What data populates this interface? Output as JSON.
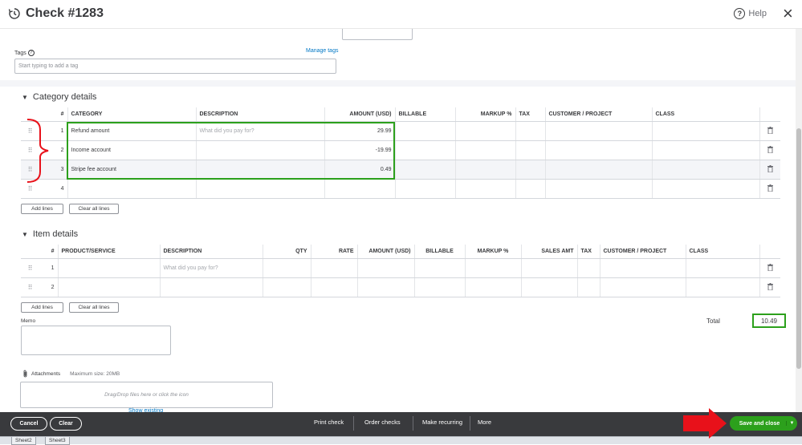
{
  "window": {
    "title": "Check #1283",
    "help_label": "Help",
    "help_glyph": "?",
    "close_glyph": "×"
  },
  "tags": {
    "label": "Tags",
    "info_glyph": "?",
    "manage_label": "Manage tags",
    "placeholder": "Start typing to add a tag"
  },
  "category_details": {
    "heading": "Category details",
    "columns": [
      "#",
      "CATEGORY",
      "DESCRIPTION",
      "AMOUNT (USD)",
      "BILLABLE",
      "MARKUP %",
      "TAX",
      "CUSTOMER / PROJECT",
      "CLASS"
    ],
    "rows": [
      {
        "num": "1",
        "category": "Refund amount",
        "description": "",
        "description_placeholder": "What did you pay for?",
        "amount": "29.99"
      },
      {
        "num": "2",
        "category": "Income account",
        "description": "",
        "amount": "-19.99"
      },
      {
        "num": "3",
        "category": "Stripe fee account",
        "description": "",
        "amount": "0.49"
      },
      {
        "num": "4",
        "category": "",
        "description": "",
        "amount": ""
      }
    ],
    "add_lines_label": "Add lines",
    "clear_lines_label": "Clear all lines"
  },
  "item_details": {
    "heading": "Item details",
    "columns": [
      "#",
      "PRODUCT/SERVICE",
      "DESCRIPTION",
      "QTY",
      "RATE",
      "AMOUNT (USD)",
      "BILLABLE",
      "MARKUP %",
      "SALES AMT",
      "TAX",
      "CUSTOMER / PROJECT",
      "CLASS"
    ],
    "rows": [
      {
        "num": "1",
        "description_placeholder": "What did you pay for?"
      },
      {
        "num": "2",
        "description_placeholder": ""
      }
    ],
    "add_lines_label": "Add lines",
    "clear_lines_label": "Clear all lines"
  },
  "memo": {
    "label": "Memo"
  },
  "total": {
    "label": "Total",
    "value": "10.49"
  },
  "attachments": {
    "label": "Attachments",
    "max_size": "Maximum size: 20MB",
    "drop_hint": "Drag/Drop files here or click the icon",
    "show_existing": "Show existing"
  },
  "footer": {
    "cancel_label": "Cancel",
    "clear_label": "Clear",
    "print_label": "Print check",
    "order_label": "Order checks",
    "recurring_label": "Make recurring",
    "more_label": "More",
    "save_label": "Save and close",
    "save_caret": "▼"
  },
  "taskbar": {
    "tabs": [
      "Sheet2",
      "Sheet3"
    ]
  },
  "colors": {
    "accent_green": "#2ca01c",
    "link_blue": "#0077c5",
    "footer_bg": "#393a3d",
    "annotation_red": "#e8111a",
    "annotation_green": "#2ca01c"
  },
  "icons": {
    "title": "history-icon",
    "help": "help-circle-icon",
    "close": "close-icon",
    "drag": "drag-handle-icon",
    "delete": "trash-icon",
    "attach": "paperclip-icon",
    "caret": "caret-down-icon"
  }
}
